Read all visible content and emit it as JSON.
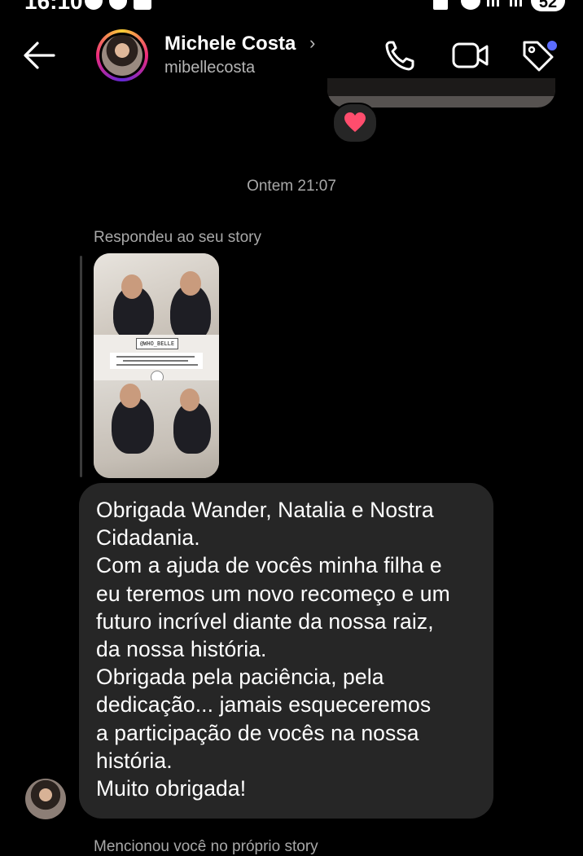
{
  "status_bar": {
    "time": "16:10",
    "battery": "52"
  },
  "header": {
    "back_icon": "arrow-left-icon",
    "contact_name": "Michele Costa",
    "chevron": "›",
    "username": "mibellecosta",
    "actions": [
      "phone-icon",
      "video-camera-icon",
      "tag-icon"
    ],
    "notification_dot_color": "#5b6cff"
  },
  "thread": {
    "reaction": "heart",
    "timestamp": "Ontem 21:07",
    "reply_context": "Respondeu ao seu story",
    "story_tag": "@WHO_BELLE",
    "message_lines": [
      "Obrigada Wander, Natalia e Nostra",
      "Cidadania.",
      "Com a ajuda de vocês minha filha e",
      "eu teremos um novo recomeço e um",
      "futuro incrível diante da nossa raiz,",
      "da nossa história.",
      "Obrigada pela paciência, pela",
      "dedicação... jamais esqueceremos",
      "a participação de vocês na nossa",
      "história.",
      "Muito obrigada!"
    ],
    "next_context": "Mencionou você no próprio story"
  },
  "colors": {
    "background": "#000000",
    "bubble": "#262626",
    "muted_text": "#a8a8a8",
    "heart": "#ff4d6d"
  }
}
